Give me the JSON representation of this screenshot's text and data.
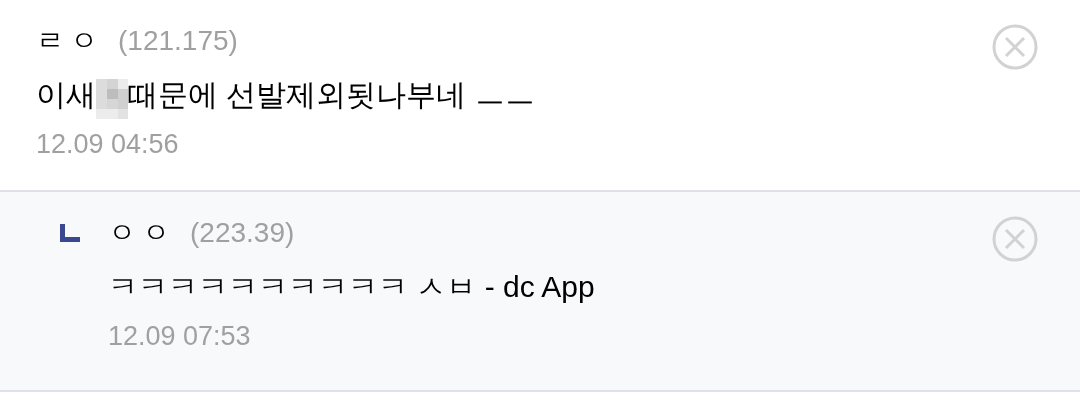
{
  "comments": [
    {
      "kind": "comment",
      "nickname": "ㄹㅇ",
      "ip": "(121.175)",
      "text_before": "이새",
      "censored": true,
      "text_after": "때문에 선발제외됫나부네 ㅡㅡ",
      "time": "12.09 04:56"
    },
    {
      "kind": "reply",
      "nickname": "ㅇㅇ",
      "ip": "(223.39)",
      "text_before": "ㅋㅋㅋㅋㅋㅋㅋㅋㅋㅋ ㅅㅂ - dc App",
      "censored": false,
      "time": "12.09 07:53"
    }
  ]
}
